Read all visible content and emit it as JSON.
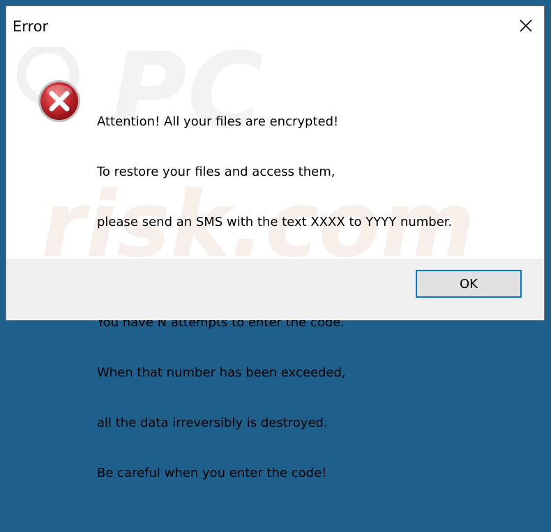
{
  "dialog": {
    "title": "Error",
    "close_icon": "close-icon",
    "error_icon": "error-x-icon",
    "paragraphs": [
      {
        "lines": [
          "Attention! All your files are encrypted!",
          "To restore your files and access them,",
          "please send an SMS with the text XXXX to YYYY number."
        ]
      },
      {
        "lines": [
          "You have N attempts to enter the code.",
          "When that number has been exceeded,",
          "all the data irreversibly is destroyed.",
          "Be careful when you enter the code!"
        ]
      }
    ],
    "ok_label": "OK",
    "watermark": "PC risk.com"
  },
  "colors": {
    "accent": "#0078d7",
    "error_red": "#c1272d",
    "footer_bg": "#f0f0f0",
    "desktop_bg": "#1f5f8c"
  }
}
